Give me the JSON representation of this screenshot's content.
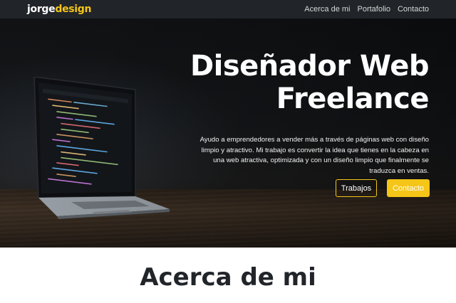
{
  "navbar": {
    "brand_part1": "jorge",
    "brand_part2": "design",
    "links": [
      "Acerca de mi",
      "Portafolio",
      "Contacto"
    ]
  },
  "hero": {
    "title_line1": "Diseñador Web",
    "title_line2": "Freelance",
    "description": "Ayudo a emprendedores a vender más a través de páginas web con diseño limpio y atractivo. Mi trabajo es convertir la idea que tienes en la cabeza en una web atractiva, optimizada y con un diseño limpio que finalmente se traduzca en ventas.",
    "button_secondary": "Trabajos",
    "button_primary": "Contacto"
  },
  "about": {
    "title": "Acerca de mi"
  },
  "colors": {
    "accent": "#f5c518",
    "navbar_bg": "#212529",
    "text_dark": "#212529"
  }
}
